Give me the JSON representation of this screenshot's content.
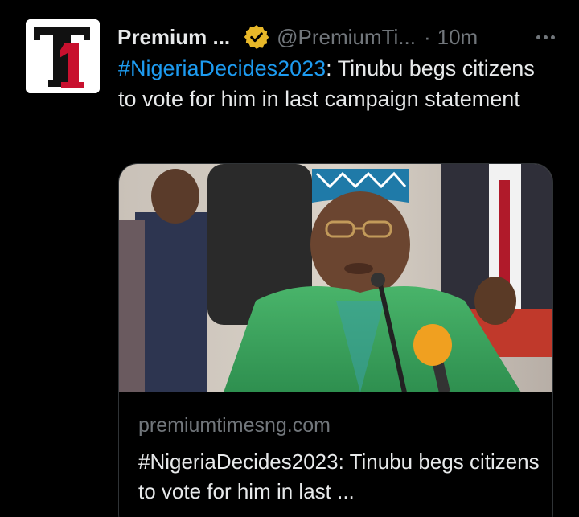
{
  "tweet": {
    "author_name": "Premium ...",
    "handle": "@PremiumTi...",
    "separator": "·",
    "time": "10m",
    "verified_icon": "gold-verified-badge-icon",
    "avatar_icon": "premium-times-logo-icon",
    "more_icon": "more-options-icon",
    "hashtag": "#NigeriaDecides2023",
    "body": ": Tinubu begs citizens to vote for him in last campaign statement"
  },
  "card": {
    "image_icon": "article-photo",
    "domain": "premiumtimesng.com",
    "title": "#NigeriaDecides2023: Tinubu begs citizens to vote for him in last ..."
  },
  "colors": {
    "background": "#000000",
    "text": "#e7e9ea",
    "muted": "#71767b",
    "link": "#1d9bf0",
    "verified_gold": "#e8b829",
    "border": "#2f3336"
  }
}
